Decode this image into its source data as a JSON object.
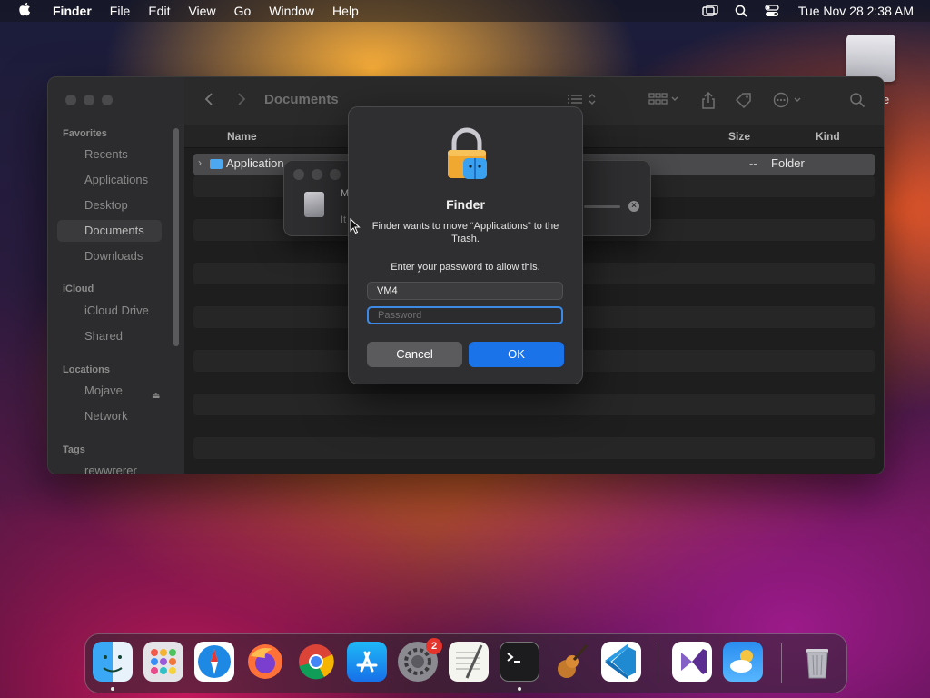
{
  "menubar": {
    "app_name": "Finder",
    "menus": [
      "File",
      "Edit",
      "View",
      "Go",
      "Window",
      "Help"
    ],
    "clock": "Tue Nov 28  2:38 AM",
    "status_icons": [
      "screen-mirroring-icon",
      "spotlight-search-icon",
      "control-center-icon"
    ]
  },
  "desktop": {
    "drive_label": "e"
  },
  "finder": {
    "title": "Documents",
    "sidebar": {
      "favorites_header": "Favorites",
      "favorites": [
        "Recents",
        "Applications",
        "Desktop",
        "Documents",
        "Downloads"
      ],
      "selected": "Documents",
      "icloud_header": "iCloud",
      "icloud": [
        "iCloud Drive",
        "Shared"
      ],
      "locations_header": "Locations",
      "locations": [
        "Mojave",
        "Network"
      ],
      "tags_header": "Tags",
      "tags": [
        "rewwrerer"
      ]
    },
    "columns": {
      "name": "Name",
      "size": "Size",
      "kind": "Kind"
    },
    "rows": [
      {
        "name": "Application",
        "size": "--",
        "kind": "Folder"
      }
    ]
  },
  "progress_window": {
    "line1": "M",
    "line2": "It"
  },
  "dialog": {
    "title": "Finder",
    "message": "Finder wants to move “Applications” to the Trash.",
    "prompt": "Enter your password to allow this.",
    "username_value": "VM4",
    "password_placeholder": "Password",
    "cancel_label": "Cancel",
    "ok_label": "OK"
  },
  "dock": {
    "apps": [
      "Finder",
      "Launchpad",
      "Safari",
      "Firefox",
      "Chrome",
      "App Store",
      "System Settings",
      "TextEdit",
      "Terminal",
      "GarageBand",
      "Visual Studio Code",
      "Visual Studio",
      "Weather",
      "Trash"
    ],
    "system_settings_badge": "2"
  },
  "colors": {
    "accent": "#1a73e8",
    "focus_ring": "#3d8ae6",
    "badge": "#e5342c"
  }
}
